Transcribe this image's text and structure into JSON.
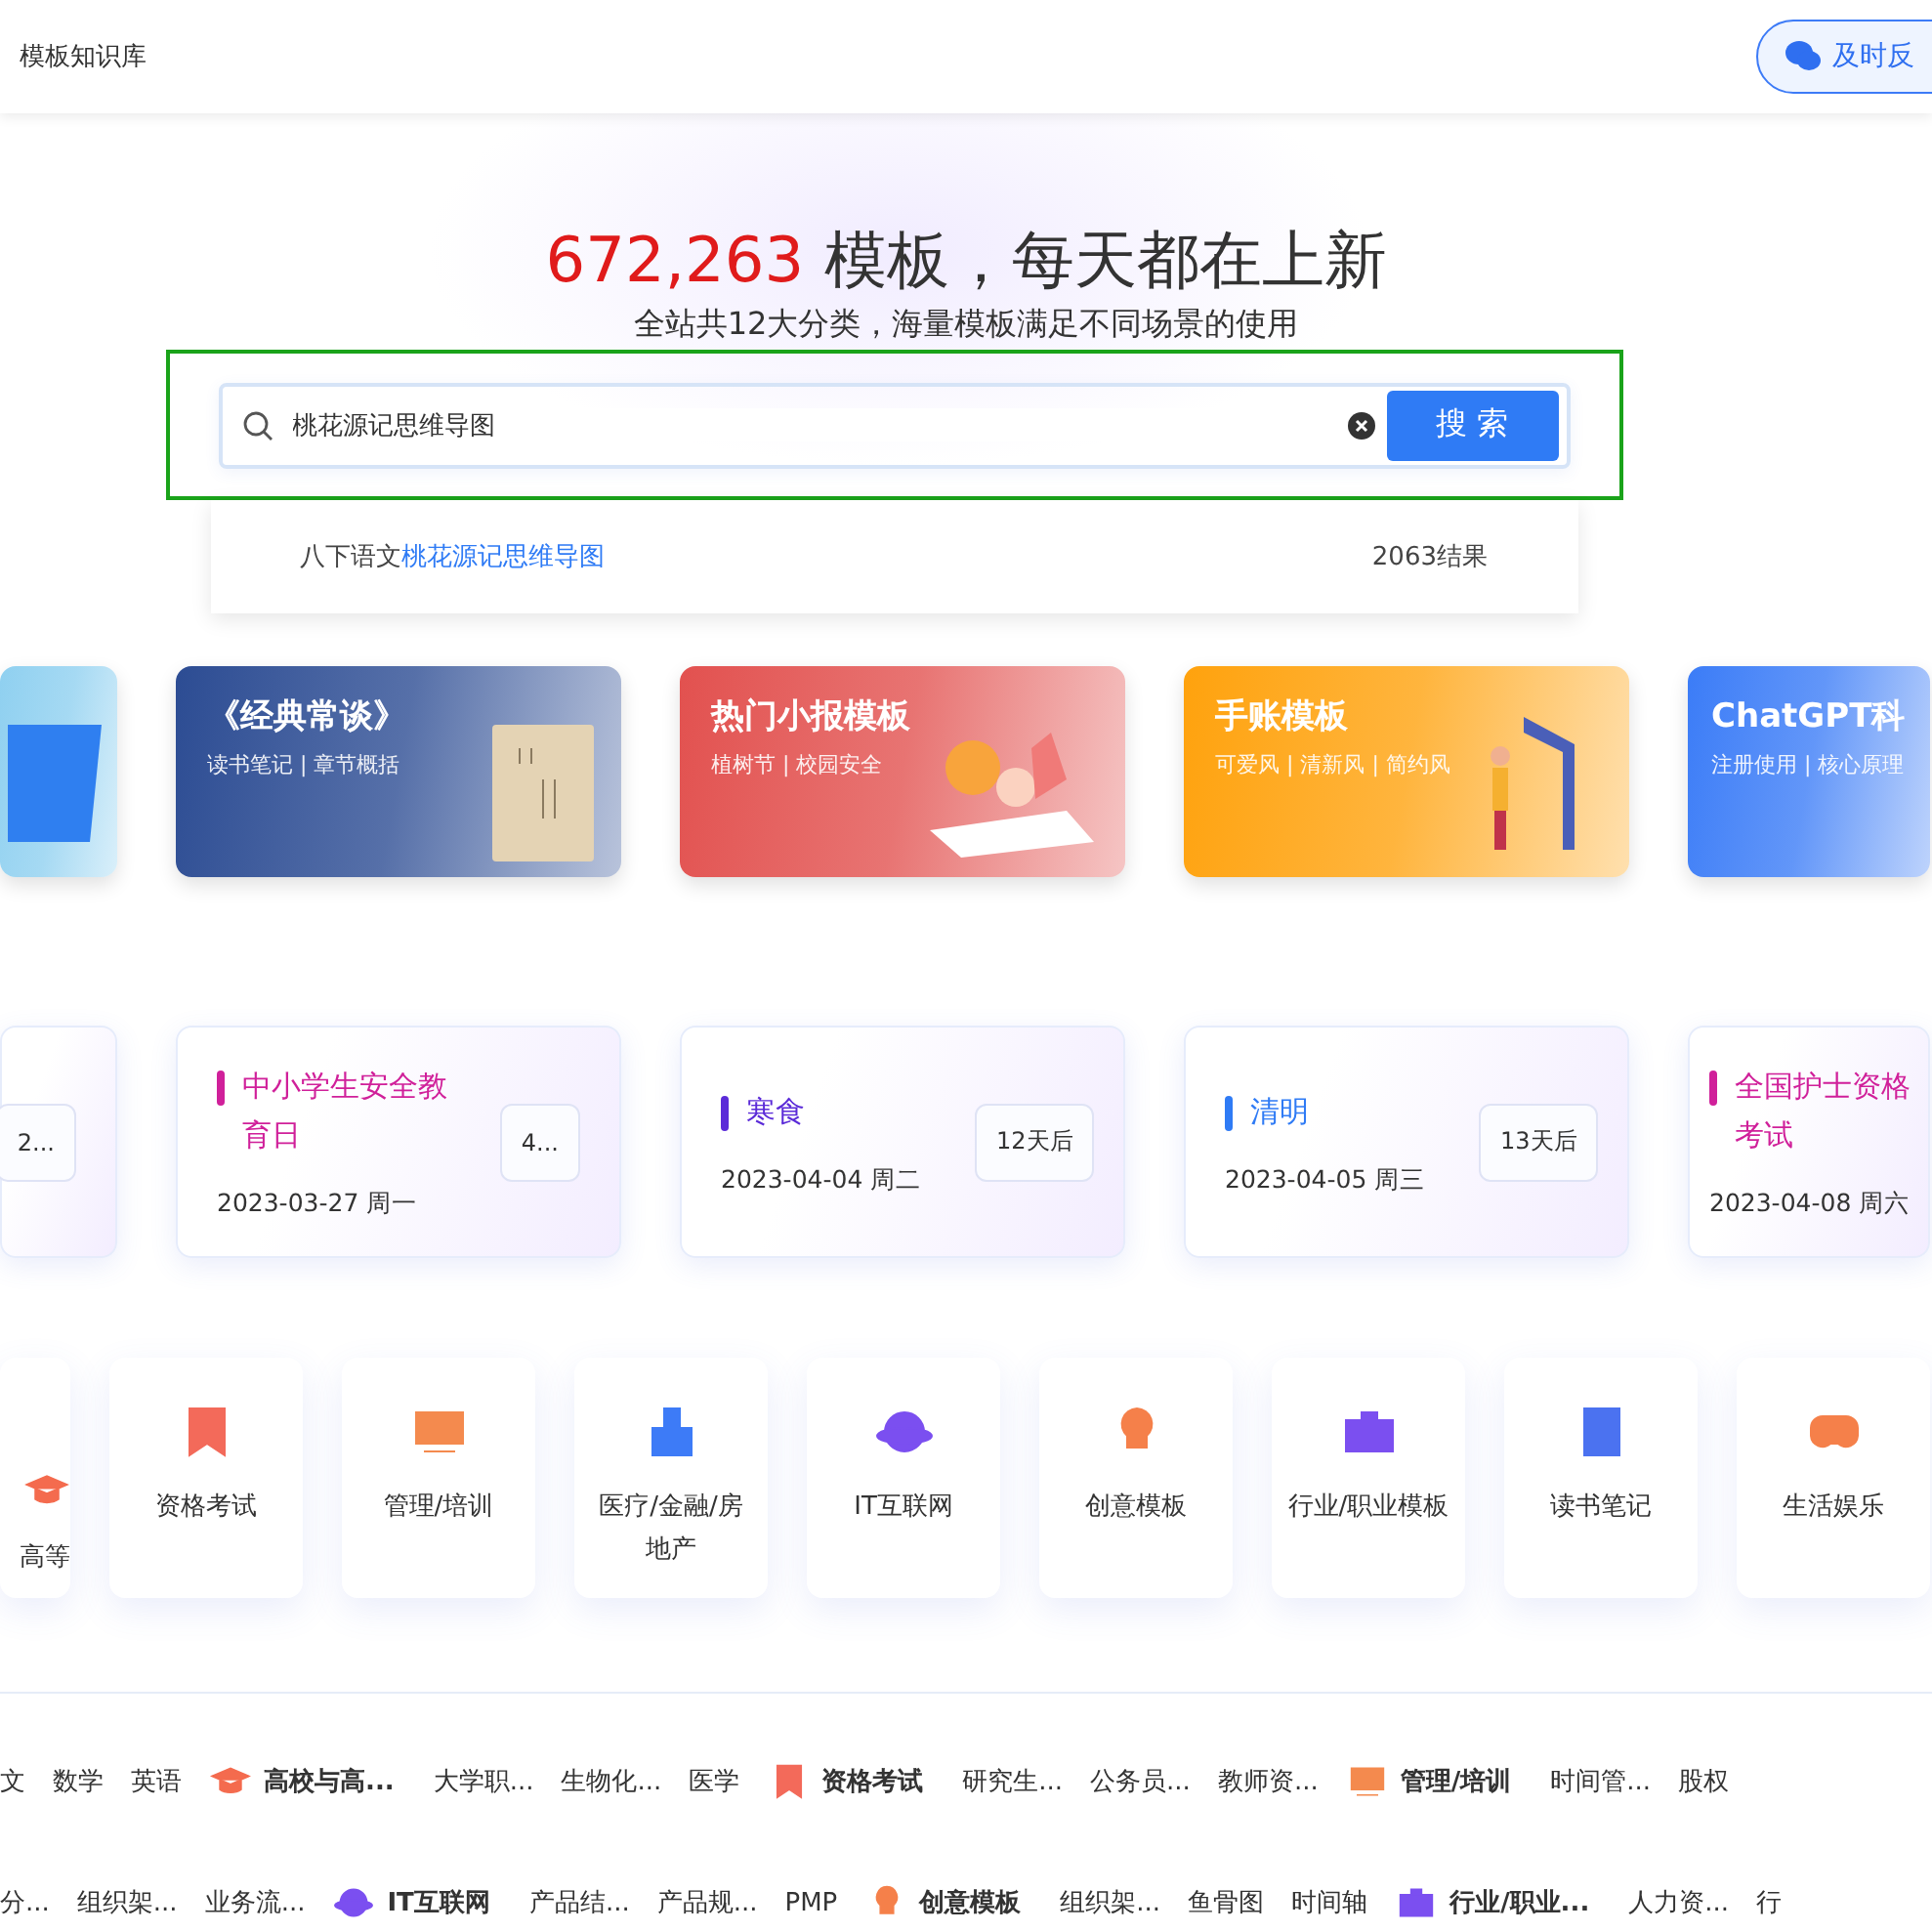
{
  "header": {
    "site_label": "模板知识库",
    "feedback_button": "及时反"
  },
  "hero": {
    "count": "672,263",
    "title": "模板，每天都在上新",
    "subtitle": "全站共12大分类，海量模板满足不同场景的使用"
  },
  "search": {
    "value": "桃花源记思维导图",
    "button": "搜 索",
    "highlighted": true,
    "suggestions": [
      {
        "prefix": "八下语文",
        "match": "桃花源记思维导图",
        "count": "2063结果"
      }
    ]
  },
  "banners": [
    {
      "kind": "partial",
      "color": "#8fd0f0"
    },
    {
      "kind": "book",
      "title": "《经典常谈》",
      "subtitle": "读书笔记 | 章节概括",
      "color": "#2c4c93"
    },
    {
      "kind": "kids",
      "title": "热门小报模板",
      "subtitle": "植树节 | 校园安全",
      "color": "#e2514f"
    },
    {
      "kind": "study",
      "title": "手账模板",
      "subtitle": "可爱风 | 清新风 | 简约风",
      "color": "#ffa20d"
    },
    {
      "kind": "plain",
      "title": "ChatGPT科",
      "subtitle": "注册使用 | 核心原理",
      "color": "#3b7cf7"
    }
  ],
  "events": [
    {
      "badge": "2..."
    },
    {
      "title": "中小学生安全教育日",
      "date": "2023-03-27 周一",
      "badge": "4...",
      "color": "#d0209a"
    },
    {
      "title": "寒食",
      "date": "2023-04-04 周二",
      "badge": "12天后",
      "color": "#5b2bd8"
    },
    {
      "title": "清明",
      "date": "2023-04-05 周三",
      "badge": "13天后",
      "color": "#2f7bf5"
    },
    {
      "title": "全国护士资格考试",
      "date": "2023-04-08 周六",
      "color": "#d0209a"
    }
  ],
  "categories": [
    {
      "kind": "cap",
      "label": "高等"
    },
    {
      "kind": "ribbon",
      "label": "资格考试"
    },
    {
      "kind": "board",
      "label": "管理/培训"
    },
    {
      "kind": "building",
      "label": "医疗/金融/房地产"
    },
    {
      "kind": "planet",
      "label": "IT互联网"
    },
    {
      "kind": "bulb",
      "label": "创意模板"
    },
    {
      "kind": "bag",
      "label": "行业/职业模板"
    },
    {
      "kind": "note",
      "label": "读书笔记"
    },
    {
      "kind": "game",
      "label": "生活娱乐"
    }
  ],
  "link_rows": [
    [
      {
        "kind": "link",
        "label": "文"
      },
      {
        "kind": "link",
        "label": "数学"
      },
      {
        "kind": "link",
        "label": "英语"
      },
      {
        "kind": "cap",
        "label": "高校与高..."
      },
      {
        "kind": "link",
        "label": "大学职..."
      },
      {
        "kind": "link",
        "label": "生物化..."
      },
      {
        "kind": "link",
        "label": "医学"
      },
      {
        "kind": "ribbon",
        "label": "资格考试"
      },
      {
        "kind": "link",
        "label": "研究生..."
      },
      {
        "kind": "link",
        "label": "公务员..."
      },
      {
        "kind": "link",
        "label": "教师资..."
      },
      {
        "kind": "board",
        "label": "管理/培训"
      },
      {
        "kind": "link",
        "label": "时间管..."
      },
      {
        "kind": "link",
        "label": "股权"
      }
    ],
    [
      {
        "kind": "link",
        "label": "分..."
      },
      {
        "kind": "link",
        "label": "组织架..."
      },
      {
        "kind": "link",
        "label": "业务流..."
      },
      {
        "kind": "planet",
        "label": "IT互联网"
      },
      {
        "kind": "link",
        "label": "产品结..."
      },
      {
        "kind": "link",
        "label": "产品规..."
      },
      {
        "kind": "link",
        "label": "PMP"
      },
      {
        "kind": "bulb",
        "label": "创意模板"
      },
      {
        "kind": "link",
        "label": "组织架..."
      },
      {
        "kind": "link",
        "label": "鱼骨图"
      },
      {
        "kind": "link",
        "label": "时间轴"
      },
      {
        "kind": "bag",
        "label": "行业/职业..."
      },
      {
        "kind": "link",
        "label": "人力资..."
      },
      {
        "kind": "link",
        "label": "行"
      }
    ]
  ]
}
